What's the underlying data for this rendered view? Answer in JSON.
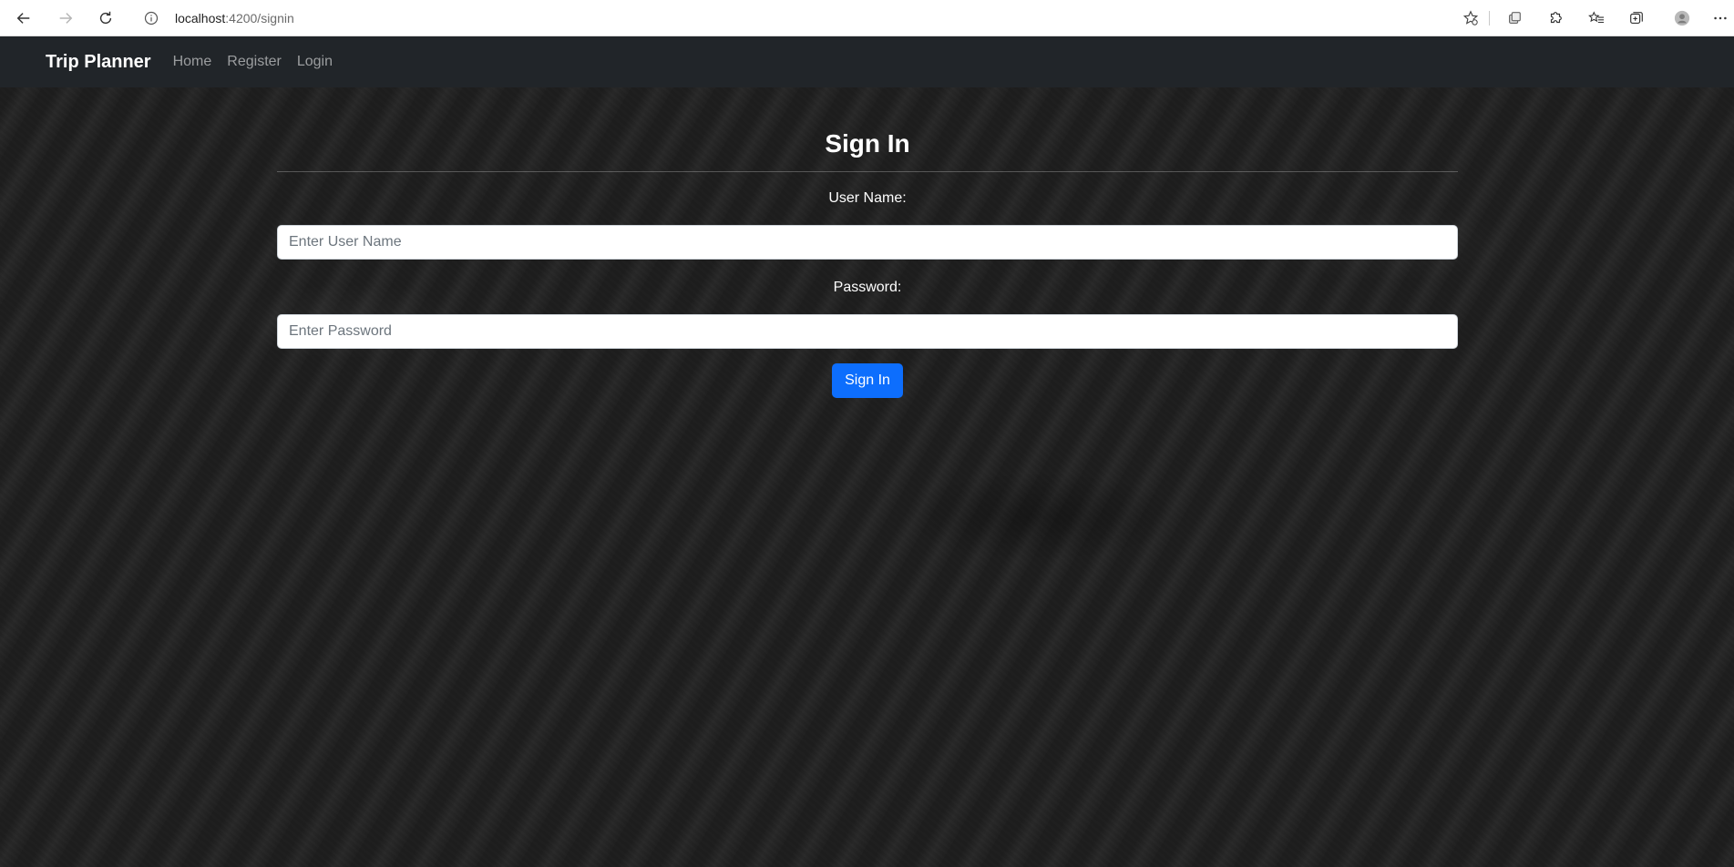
{
  "browser": {
    "url_host": "localhost",
    "url_path": ":4200/signin",
    "icons": {
      "back": "arrow-left-icon",
      "forward": "arrow-right-icon",
      "reload": "reload-icon",
      "site_info": "info-icon",
      "favorite_add": "star-add-icon",
      "tab_actions": "tabs-icon",
      "extensions": "puzzle-icon",
      "favorites": "favorites-icon",
      "collections": "collections-icon",
      "profile": "avatar-icon",
      "menu": "more-icon"
    }
  },
  "navbar": {
    "brand": "Trip Planner",
    "links": [
      "Home",
      "Register",
      "Login"
    ],
    "background": "#212529"
  },
  "form": {
    "title": "Sign In",
    "username_label": "User Name:",
    "username_placeholder": "Enter User Name",
    "username_value": "",
    "password_label": "Password:",
    "password_placeholder": "Enter Password",
    "password_value": "",
    "submit_label": "Sign In",
    "accent_color": "#0d6efd"
  }
}
